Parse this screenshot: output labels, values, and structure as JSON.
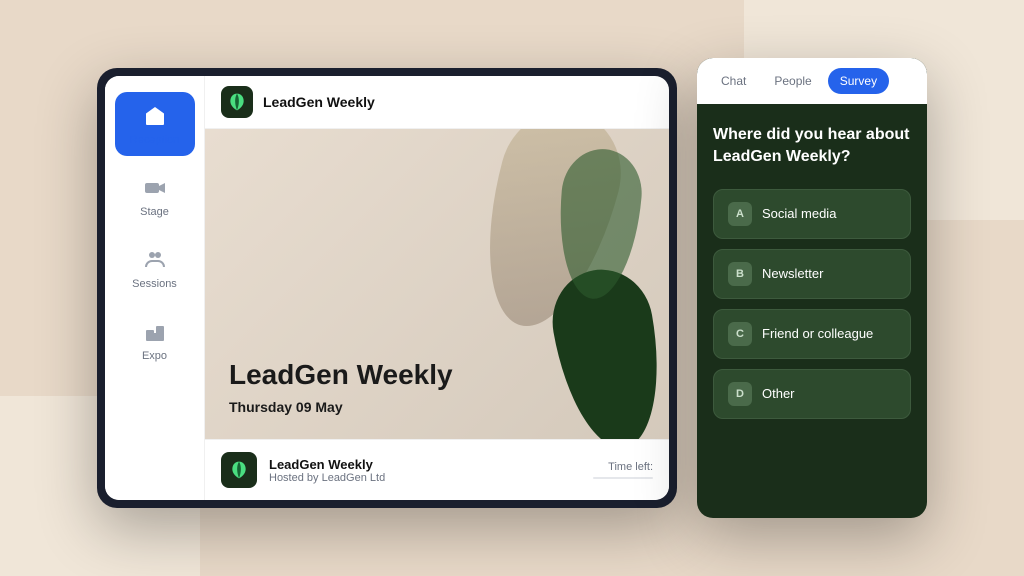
{
  "background": {
    "color": "#e8d9c8"
  },
  "topbar": {
    "title": "LeadGen Weekly"
  },
  "sidebar": {
    "items": [
      {
        "id": "reception",
        "label": "Reception",
        "active": true
      },
      {
        "id": "stage",
        "label": "Stage",
        "active": false
      },
      {
        "id": "sessions",
        "label": "Sessions",
        "active": false
      },
      {
        "id": "expo",
        "label": "Expo",
        "active": false
      }
    ]
  },
  "hero": {
    "title": "LeadGen Weekly",
    "date": "Thursday 09 May"
  },
  "bottom_bar": {
    "event_name": "LeadGen Weekly",
    "event_host": "Hosted by LeadGen Ltd",
    "time_left_label": "Time left:"
  },
  "survey": {
    "tabs": [
      {
        "label": "Chat",
        "active": false
      },
      {
        "label": "People",
        "active": false
      },
      {
        "label": "Survey",
        "active": true
      }
    ],
    "question": "Where did you hear about LeadGen Weekly?",
    "options": [
      {
        "letter": "A",
        "text": "Social media"
      },
      {
        "letter": "B",
        "text": "Newsletter"
      },
      {
        "letter": "C",
        "text": "Friend or colleague"
      },
      {
        "letter": "D",
        "text": "Other"
      }
    ]
  }
}
